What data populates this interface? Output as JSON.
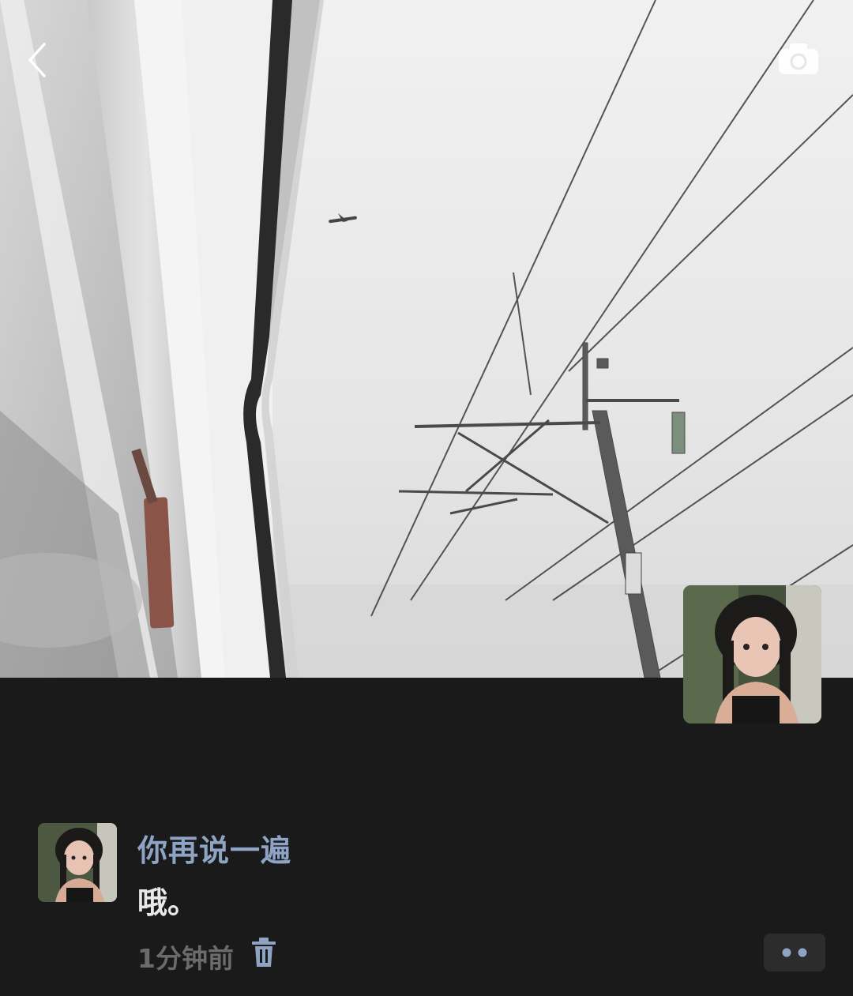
{
  "post": {
    "author": "你再说一遍",
    "text": "哦。",
    "time": "1分钟前"
  },
  "icons": {
    "back": "chevron-left-icon",
    "camera": "camera-icon",
    "delete": "trash-icon",
    "more": "more-dots-icon"
  },
  "colors": {
    "background": "#1a1a1b",
    "author": "#8fa4c4",
    "text": "#e8e8e8",
    "time": "#6b6b6b"
  }
}
